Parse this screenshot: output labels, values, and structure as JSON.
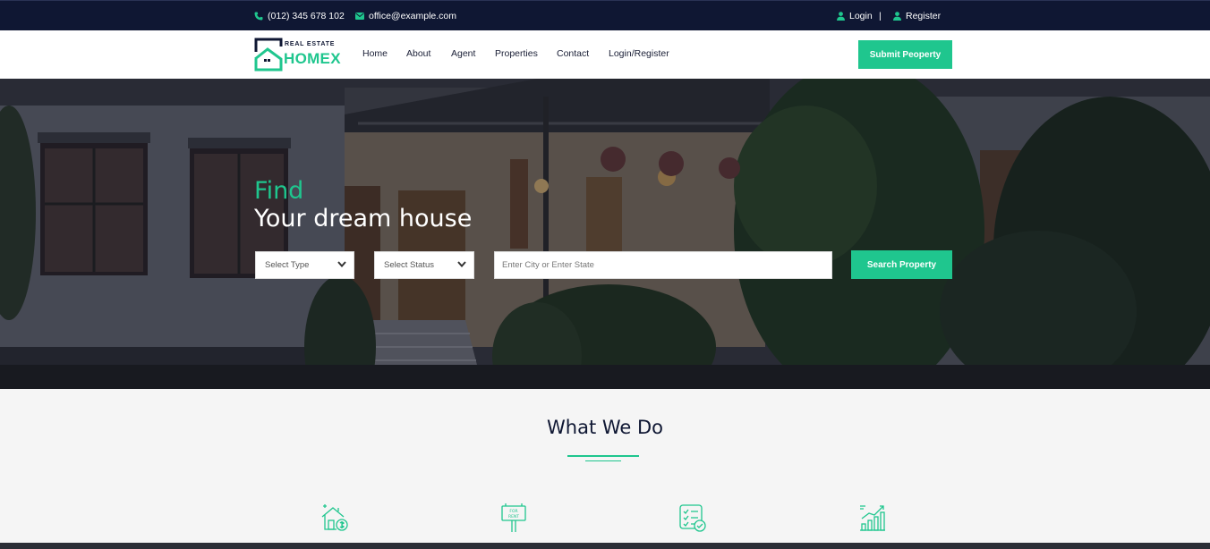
{
  "topbar": {
    "phone": "(012) 345 678 102",
    "email": "office@example.com",
    "login": "Login",
    "separator": "|",
    "register": "Register"
  },
  "navbar": {
    "logo_small": "REAL ESTATE",
    "logo_big": "HOMEX",
    "menu": [
      "Home",
      "About",
      "Agent",
      "Properties",
      "Contact",
      "Login/Register"
    ],
    "submit_button": "Submit Peoperty"
  },
  "hero": {
    "find": "Find",
    "title": "Your dream house",
    "select_type": "Select Type",
    "select_status": "Select Status",
    "city_placeholder": "Enter City or Enter State",
    "search_button": "Search Property"
  },
  "what_we_do": {
    "title": "What We Do",
    "services": [
      {
        "icon": "house-dollar-icon"
      },
      {
        "icon": "for-rent-sign-icon"
      },
      {
        "icon": "checklist-icon"
      },
      {
        "icon": "growth-chart-icon"
      }
    ]
  },
  "colors": {
    "accent": "#1fc68e",
    "dark": "#0f1733"
  }
}
